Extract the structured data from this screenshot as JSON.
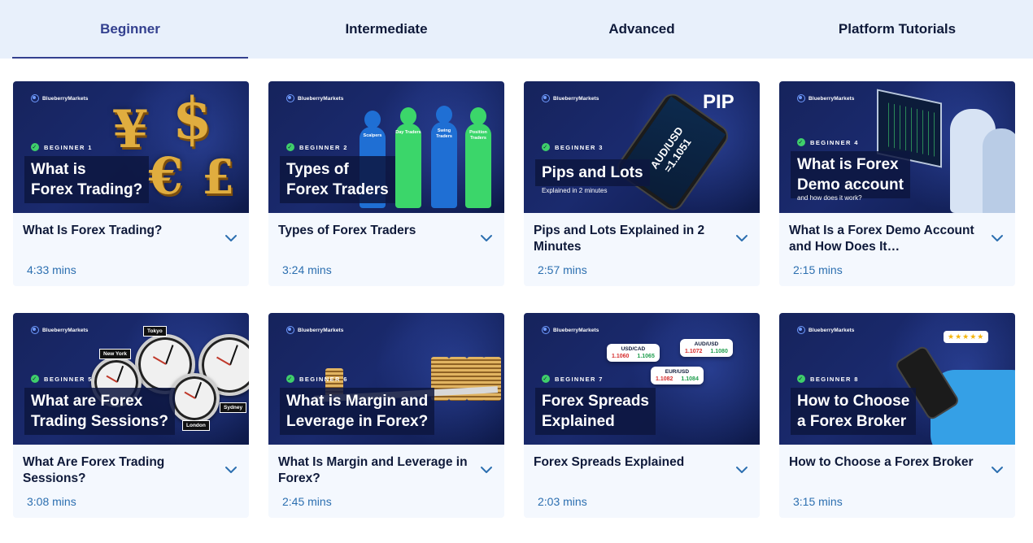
{
  "tabs": [
    {
      "label": "Beginner",
      "active": true
    },
    {
      "label": "Intermediate",
      "active": false
    },
    {
      "label": "Advanced",
      "active": false
    },
    {
      "label": "Platform Tutorials",
      "active": false
    }
  ],
  "brand": "BlueberryMarkets",
  "cards": [
    {
      "level": "BEGINNER 1",
      "thumb_title": "What is\nForex Trading?",
      "thumb_sub": "",
      "title": "What Is Forex Trading?",
      "duration": "4:33 mins"
    },
    {
      "level": "BEGINNER 2",
      "thumb_title": "Types of\nForex Traders",
      "thumb_sub": "",
      "title": "Types of Forex Traders",
      "duration": "3:24 mins",
      "figures": [
        "Scalpers",
        "Day Traders",
        "Swing Traders",
        "Position Traders"
      ]
    },
    {
      "level": "BEGINNER 3",
      "thumb_title": "Pips and Lots",
      "thumb_sub": "Explained in 2 minutes",
      "title": "Pips and Lots Explained in 2 Minutes",
      "duration": "2:57 mins",
      "pip": "PIP",
      "tablet": "AUD/USD\n=1.1051"
    },
    {
      "level": "BEGINNER 4",
      "thumb_title": "What is Forex\nDemo account",
      "thumb_sub": "and how does it work?",
      "title": "What Is a Forex Demo Account and How Does It…",
      "duration": "2:15 mins"
    },
    {
      "level": "BEGINNER 5",
      "thumb_title": "What are Forex\nTrading Sessions?",
      "thumb_sub": "",
      "title": "What Are Forex Trading Sessions?",
      "duration": "3:08 mins",
      "cities": [
        "Tokyo",
        "New York",
        "Sydney",
        "London"
      ]
    },
    {
      "level": "BEGINNER 6",
      "thumb_title": "What is Margin and\nLeverage in Forex?",
      "thumb_sub": "",
      "title": "What Is Margin and Leverage in Forex?",
      "duration": "2:45 mins"
    },
    {
      "level": "BEGINNER 7",
      "thumb_title": "Forex Spreads\nExplained",
      "thumb_sub": "",
      "title": "Forex Spreads Explained",
      "duration": "2:03 mins",
      "quotes": [
        {
          "pair": "USD/CAD",
          "bid": "1.1060",
          "ask": "1.1065"
        },
        {
          "pair": "AUD/USD",
          "bid": "1.1072",
          "ask": "1.1080"
        },
        {
          "pair": "EUR/USD",
          "bid": "1.1082",
          "ask": "1.1084"
        }
      ]
    },
    {
      "level": "BEGINNER 8",
      "thumb_title": "How to Choose\na Forex Broker",
      "thumb_sub": "",
      "title": "How to Choose a Forex Broker",
      "duration": "3:15 mins",
      "stars": "★★★★★"
    }
  ],
  "colors": {
    "tab_bg": "#e8f0fb",
    "accent": "#33408f",
    "card_bg": "#f4f8fe",
    "duration": "#2c6fb0",
    "thumb_dark": "#16235c"
  },
  "icons": {
    "chevron": "chevron-down-icon",
    "check": "check-circle-icon",
    "logo": "blueberry-logo-icon"
  }
}
